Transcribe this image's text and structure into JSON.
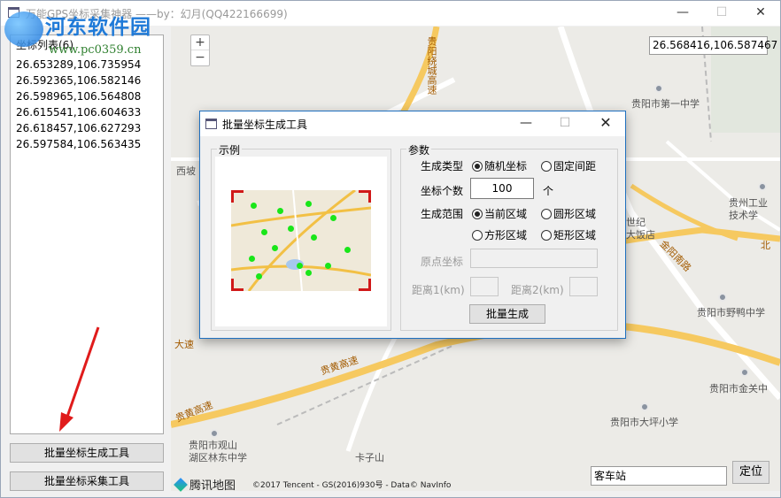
{
  "app": {
    "title": "万能GPS坐标采集神器 ——by：幻月(QQ422166699)",
    "window_controls": {
      "minimize": "—",
      "maximize": "☐",
      "close": "✕"
    }
  },
  "watermark": {
    "title": "河东软件园",
    "url": "www.pc0359.cn"
  },
  "coord_list": {
    "header": "坐标列表(6)",
    "items": [
      "26.653289,106.735954",
      "26.592365,106.582146",
      "26.598965,106.564808",
      "26.615541,106.604633",
      "26.618457,106.627293",
      "26.597584,106.563435"
    ]
  },
  "buttons": {
    "batch_generate_tool": "批量坐标生成工具",
    "batch_collect_tool": "批量坐标采集工具",
    "locate": "定位"
  },
  "map": {
    "zoom_in": "+",
    "zoom_out": "−",
    "coordinate_readout": "26.568416,106.587467",
    "search_value": "客车站",
    "logo_text": "腾讯地图",
    "copyright": "©2017 Tencent - GS(2016)930号 - Data© NavInfo",
    "labels": {
      "guiyang_ring": "贵阳绕城高速",
      "no1_middle_school": "贵阳市第一中学",
      "xipo": "西坡",
      "gzut_college": "贵州工业\n技术学",
      "shiji_hotel": "世纪\n大饭店",
      "jinyang_south": "金阳南路",
      "yeyazi_school": "贵阳市野鸭中学",
      "guiyang_highway": "贵黄高速",
      "jinguan_middle": "贵阳市金关中",
      "dapingzi_school": "贵阳市大坪小学",
      "guanshanhu_school": "贵阳市观山\n湖区林东中学",
      "kazishan": "卡子山",
      "dasu": "大速",
      "north": "北"
    }
  },
  "dialog": {
    "title": "批量坐标生成工具",
    "window_controls": {
      "minimize": "—",
      "maximize": "☐",
      "close": "✕"
    },
    "example_group": "示例",
    "params_group": "参数",
    "gen_type_label": "生成类型",
    "gen_type_options": [
      "随机坐标",
      "固定间距"
    ],
    "gen_type_selected": "随机坐标",
    "count_label": "坐标个数",
    "count_value": "100",
    "count_unit": "个",
    "range_label": "生成范围",
    "range_options": [
      "当前区域",
      "圆形区域",
      "方形区域",
      "矩形区域"
    ],
    "range_selected": "当前区域",
    "origin_label": "原点坐标",
    "origin_value": "",
    "distance1_label": "距离1(km)",
    "distance2_label": "距离2(km)",
    "batch_button": "批量生成"
  },
  "colors": {
    "accent": "#1e6fbf",
    "watermark_blue": "#1f7ad8",
    "watermark_green": "#2e7f2e",
    "example_corner_red": "#d01919",
    "example_dot_green": "#19e619",
    "arrow_red": "#e01b1b"
  }
}
